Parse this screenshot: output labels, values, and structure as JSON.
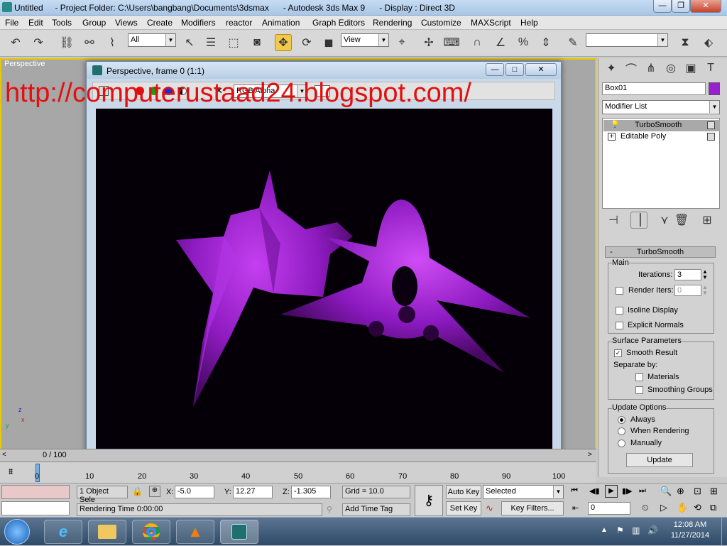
{
  "window": {
    "title": "Untitled     - Project Folder: C:\\Users\\bangbang\\Documents\\3dsmax      - Autodesk 3ds Max 9      - Display : Direct 3D",
    "min": "—",
    "max": "❐",
    "close": "✕"
  },
  "menu": [
    "File",
    "Edit",
    "Tools",
    "Group",
    "Views",
    "Create",
    "Modifiers",
    "reactor",
    "Animation",
    "Graph Editors",
    "Rendering",
    "Customize",
    "MAXScript",
    "Help"
  ],
  "toolbar": {
    "selection_filter": "All",
    "ref_coord": "View",
    "named_sel": ""
  },
  "viewport": {
    "label": "Perspective"
  },
  "watermark": "http://computerustaad24.blogspot.com/",
  "render_window": {
    "title": "Perspective, frame 0 (1:1)",
    "channel": "RGB Alpha",
    "min": "—",
    "max": "□",
    "close": "✕"
  },
  "command_panel": {
    "object_name": "Box01",
    "object_color": "#9a1fd0",
    "modifier_list": "Modifier List",
    "stack": [
      "TurboSmooth",
      "Editable Poly"
    ],
    "rollout_title": "TurboSmooth",
    "main_label": "Main",
    "iterations_label": "Iterations:",
    "iterations_value": "3",
    "render_iters_label": "Render Iters:",
    "render_iters_value": "0",
    "isoline_label": "Isoline Display",
    "explicit_normals_label": "Explicit Normals",
    "surface_label": "Surface Parameters",
    "smooth_result_label": "Smooth Result",
    "separate_by_label": "Separate by:",
    "materials_label": "Materials",
    "smoothing_groups_label": "Smoothing Groups",
    "update_options_label": "Update Options",
    "always_label": "Always",
    "when_rendering_label": "When Rendering",
    "manually_label": "Manually",
    "update_button": "Update"
  },
  "timeline": {
    "frame_display": "0 / 100",
    "ticks": [
      "0",
      "10",
      "20",
      "30",
      "40",
      "50",
      "60",
      "70",
      "80",
      "90",
      "100"
    ]
  },
  "status": {
    "selection": "1 Object Sele",
    "x_label": "X:",
    "x_value": "-5.0",
    "y_label": "Y:",
    "y_value": "12.27",
    "z_label": "Z:",
    "z_value": "-1.305",
    "grid": "Grid = 10.0",
    "auto_key": "Auto Key",
    "set_key": "Set Key",
    "key_mode": "Selected",
    "key_filters": "Key Filters...",
    "frame_field": "0",
    "render_time": "Rendering Time  0:00:00",
    "add_time_tag": "Add Time Tag"
  },
  "clock": {
    "time": "12:08 AM",
    "date": "11/27/2014"
  }
}
